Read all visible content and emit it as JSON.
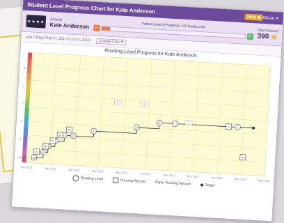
{
  "window": {
    "title": "Student Level Progress Chart for Kate Anderson",
    "help_label": "Help ⊕",
    "close_label": "Close ✕"
  },
  "student": {
    "grade_label": "Admiral",
    "name": "Kate Anderson",
    "avatar_text": "★★★★",
    "progress_label": "Fables Level B Progress: 115 Books Left!",
    "current_level": "B",
    "next_level": "C",
    "progress_fraction": 0.06,
    "score_label": "Stars Earned",
    "score_value": "390"
  },
  "filter": {
    "date_range": "Last 7 Days (Sep 27, 2012 to Oct 3, 2012)",
    "select_label": "Change Date ▼"
  },
  "chart": {
    "title": "Reading Level Progress for Kate Anderson",
    "colors": {
      "plot_bg": "#fdfbd4",
      "grid": "#ece6a8",
      "line": "#333333",
      "level_bar": [
        "#b55b8f",
        "#c26fa0",
        "#9a6cc0",
        "#7b74cf",
        "#5d86d6",
        "#4ea3c9",
        "#46b3a7",
        "#5bbb74",
        "#86c35a",
        "#b3c84b",
        "#d7c646",
        "#e8b44a",
        "#ea984c",
        "#e47f4f",
        "#dc6a58",
        "#cf5563"
      ]
    },
    "x_labels": [
      "Sep 2011",
      "Nov 2011",
      "Jan 2012",
      "Mar 2012",
      "May 2012",
      "Jul 2012",
      "Sep 2012",
      "Nov 2012",
      "Jan 2013",
      "Mar 2013",
      "May 2013"
    ],
    "y_labels": [
      "aa",
      "A",
      "B",
      "C",
      "D",
      "E",
      "F",
      "G",
      "H",
      "I",
      "J",
      "K",
      "L",
      "M",
      "N",
      "O"
    ],
    "reading_levels": [
      {
        "x": 0.0,
        "y": 0,
        "label": "aa"
      },
      {
        "x": 0.04,
        "y": 1,
        "label": "A"
      },
      {
        "x": 0.06,
        "y": 2,
        "label": "B"
      },
      {
        "x": 0.09,
        "y": 3,
        "label": "C"
      },
      {
        "x": 0.13,
        "y": 4,
        "label": "D"
      },
      {
        "x": 0.17,
        "y": 4,
        "label": "E"
      },
      {
        "x": 0.26,
        "y": 5,
        "label": "F"
      },
      {
        "x": 0.45,
        "y": 6,
        "label": "G"
      },
      {
        "x": 0.55,
        "y": 7,
        "label": "H"
      },
      {
        "x": 0.62,
        "y": 7,
        "label": "I"
      },
      {
        "x": 0.9,
        "y": 7,
        "label": "J"
      }
    ],
    "running_records": [
      {
        "x": 0.01,
        "y": 1,
        "label": "A"
      },
      {
        "x": 0.05,
        "y": 2,
        "label": "B"
      },
      {
        "x": 0.08,
        "y": 3,
        "label": "C"
      },
      {
        "x": 0.11,
        "y": 4,
        "label": "D"
      },
      {
        "x": 0.15,
        "y": 5,
        "label": "E"
      },
      {
        "x": 0.86,
        "y": 7,
        "label": "J"
      },
      {
        "x": 0.93,
        "y": 2,
        "label": "K"
      }
    ],
    "floating_labels": [
      {
        "x": 0.36,
        "y": 10,
        "label": "K"
      },
      {
        "x": 0.48,
        "y": 10,
        "label": "L"
      },
      {
        "x": 0.68,
        "y": 7.3,
        "label": "J"
      }
    ],
    "target": {
      "x": 0.97,
      "y": 7
    },
    "legend": {
      "reading_level": "Reading Level",
      "running_record": "Running Record",
      "paper_record": "Paper Running Record",
      "target": "Target"
    }
  }
}
